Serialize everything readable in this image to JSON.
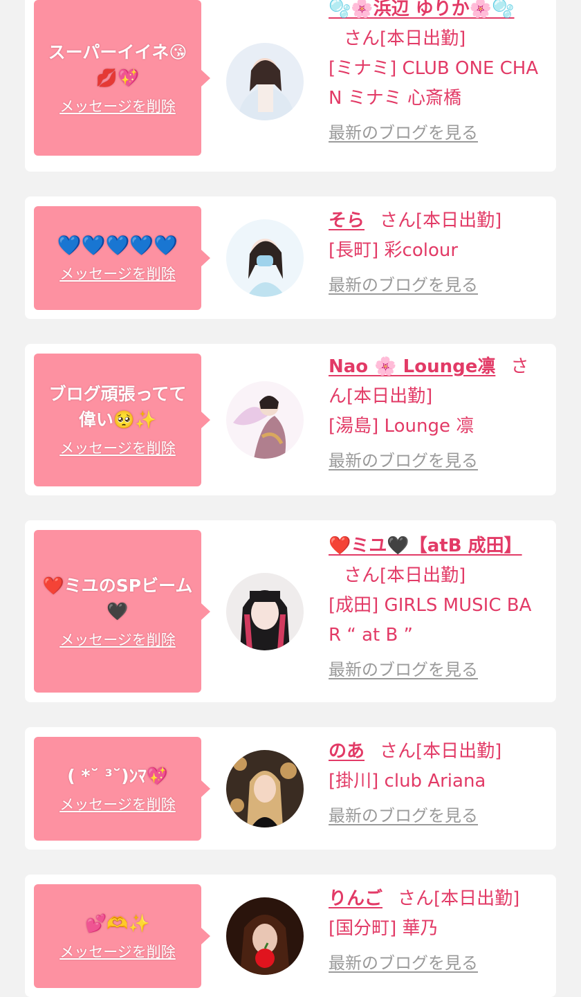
{
  "delete_label": "メッセージを削除",
  "blog_label": "最新のブログを見る",
  "san_label": "さん",
  "shift_label": "[本日出勤]",
  "colors": {
    "background": "#f2f2f2",
    "card": "#ffffff",
    "bubble": "#fd91a1",
    "accent": "#e23a66",
    "muted": "#9a9a9a"
  },
  "cards": [
    {
      "message": "スーパーイイネ😘💋💖",
      "name": "🫧🌸浜辺 ゆりか🌸🫧",
      "area": "[ミナミ] CLUB ONE CHAN ミナミ 心斎橋"
    },
    {
      "message": "💙💙💙💙💙",
      "name": "そら",
      "area": "[長町] 彩colour"
    },
    {
      "message": "ブログ頑張ってて偉い🥺✨",
      "name": "Nao 🌸 Lounge凛",
      "area": "[湯島] Lounge 凛"
    },
    {
      "message": "❤️ミユのSPビーム🖤",
      "name": "❤️ミユ🖤【atB 成田】",
      "area": "[成田] GIRLS MUSIC BAR “ at B ”"
    },
    {
      "message": "( *˘ ³˘)ﾝﾏ💖",
      "name": "のあ",
      "area": "[掛川] club Ariana"
    },
    {
      "message": "💕🫶✨",
      "name": "りんご",
      "area": "[国分町] 華乃"
    }
  ]
}
